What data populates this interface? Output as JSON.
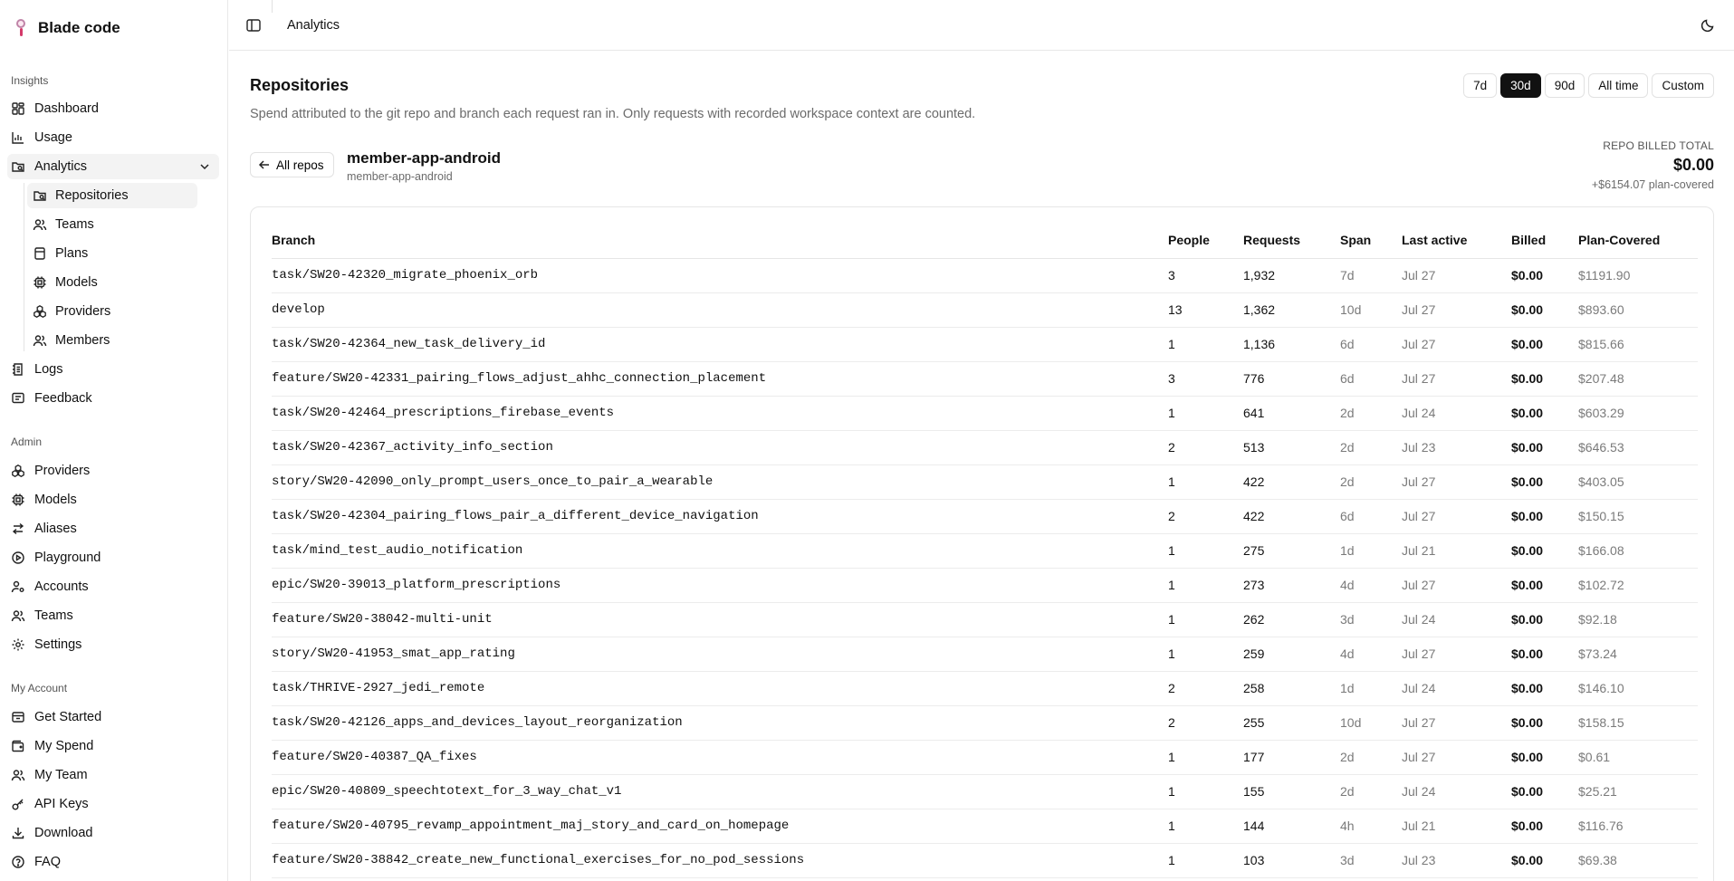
{
  "brand": {
    "name": "Blade code"
  },
  "sidebar": {
    "sections": [
      {
        "label": "Insights"
      },
      {
        "label": "Admin"
      },
      {
        "label": "My Account"
      }
    ],
    "insights": [
      {
        "label": "Dashboard",
        "icon": "layout-grid-icon"
      },
      {
        "label": "Usage",
        "icon": "bar-chart-icon"
      },
      {
        "label": "Analytics",
        "icon": "folder-search-icon"
      }
    ],
    "analytics_sub": [
      {
        "label": "Repositories",
        "icon": "folder-search-icon"
      },
      {
        "label": "Teams",
        "icon": "users-icon"
      },
      {
        "label": "Plans",
        "icon": "file-icon"
      },
      {
        "label": "Models",
        "icon": "cpu-icon"
      },
      {
        "label": "Providers",
        "icon": "boxes-icon"
      },
      {
        "label": "Members",
        "icon": "users-icon"
      }
    ],
    "insights_tail": [
      {
        "label": "Logs",
        "icon": "logs-icon"
      },
      {
        "label": "Feedback",
        "icon": "message-icon"
      }
    ],
    "admin": [
      {
        "label": "Providers",
        "icon": "boxes-icon"
      },
      {
        "label": "Models",
        "icon": "cpu-icon"
      },
      {
        "label": "Aliases",
        "icon": "arrows-icon"
      },
      {
        "label": "Playground",
        "icon": "play-circle-icon"
      },
      {
        "label": "Accounts",
        "icon": "user-cog-icon"
      },
      {
        "label": "Teams",
        "icon": "users-icon"
      },
      {
        "label": "Settings",
        "icon": "gear-icon"
      }
    ],
    "account": [
      {
        "label": "Get Started",
        "icon": "rocket-icon"
      },
      {
        "label": "My Spend",
        "icon": "wallet-icon"
      },
      {
        "label": "My Team",
        "icon": "users-icon"
      },
      {
        "label": "API Keys",
        "icon": "key-icon"
      },
      {
        "label": "Download",
        "icon": "download-icon"
      },
      {
        "label": "FAQ",
        "icon": "help-circle-icon"
      }
    ]
  },
  "topbar": {
    "breadcrumb": "Analytics"
  },
  "page": {
    "title": "Repositories",
    "description": "Spend attributed to the git repo and branch each request ran in. Only requests with recorded workspace context are counted.",
    "ranges": [
      "7d",
      "30d",
      "90d",
      "All time",
      "Custom"
    ],
    "selected_range": "30d"
  },
  "repo": {
    "back_label": "All repos",
    "name": "member-app-android",
    "subtitle": "member-app-android",
    "billed_label": "REPO BILLED TOTAL",
    "billed_value": "$0.00",
    "plan_covered": "+$6154.07 plan-covered"
  },
  "table": {
    "headers": [
      "Branch",
      "People",
      "Requests",
      "Span",
      "Last active",
      "Billed",
      "Plan-Covered"
    ],
    "rows": [
      [
        "task/SW20-42320_migrate_phoenix_orb",
        "3",
        "1,932",
        "7d",
        "Jul 27",
        "$0.00",
        "$1191.90"
      ],
      [
        "develop",
        "13",
        "1,362",
        "10d",
        "Jul 27",
        "$0.00",
        "$893.60"
      ],
      [
        "task/SW20-42364_new_task_delivery_id",
        "1",
        "1,136",
        "6d",
        "Jul 27",
        "$0.00",
        "$815.66"
      ],
      [
        "feature/SW20-42331_pairing_flows_adjust_ahhc_connection_placement",
        "3",
        "776",
        "6d",
        "Jul 27",
        "$0.00",
        "$207.48"
      ],
      [
        "task/SW20-42464_prescriptions_firebase_events",
        "1",
        "641",
        "2d",
        "Jul 24",
        "$0.00",
        "$603.29"
      ],
      [
        "task/SW20-42367_activity_info_section",
        "2",
        "513",
        "2d",
        "Jul 23",
        "$0.00",
        "$646.53"
      ],
      [
        "story/SW20-42090_only_prompt_users_once_to_pair_a_wearable",
        "1",
        "422",
        "2d",
        "Jul 27",
        "$0.00",
        "$403.05"
      ],
      [
        "task/SW20-42304_pairing_flows_pair_a_different_device_navigation",
        "2",
        "422",
        "6d",
        "Jul 27",
        "$0.00",
        "$150.15"
      ],
      [
        "task/mind_test_audio_notification",
        "1",
        "275",
        "1d",
        "Jul 21",
        "$0.00",
        "$166.08"
      ],
      [
        "epic/SW20-39013_platform_prescriptions",
        "1",
        "273",
        "4d",
        "Jul 27",
        "$0.00",
        "$102.72"
      ],
      [
        "feature/SW20-38042-multi-unit",
        "1",
        "262",
        "3d",
        "Jul 24",
        "$0.00",
        "$92.18"
      ],
      [
        "story/SW20-41953_smat_app_rating",
        "1",
        "259",
        "4d",
        "Jul 27",
        "$0.00",
        "$73.24"
      ],
      [
        "task/THRIVE-2927_jedi_remote",
        "2",
        "258",
        "1d",
        "Jul 24",
        "$0.00",
        "$146.10"
      ],
      [
        "task/SW20-42126_apps_and_devices_layout_reorganization",
        "2",
        "255",
        "10d",
        "Jul 27",
        "$0.00",
        "$158.15"
      ],
      [
        "feature/SW20-40387_QA_fixes",
        "1",
        "177",
        "2d",
        "Jul 27",
        "$0.00",
        "$0.61"
      ],
      [
        "epic/SW20-40809_speechtotext_for_3_way_chat_v1",
        "1",
        "155",
        "2d",
        "Jul 24",
        "$0.00",
        "$25.21"
      ],
      [
        "feature/SW20-40795_revamp_appointment_maj_story_and_card_on_homepage",
        "1",
        "144",
        "4h",
        "Jul 21",
        "$0.00",
        "$116.76"
      ],
      [
        "feature/SW20-38842_create_new_functional_exercises_for_no_pod_sessions",
        "1",
        "103",
        "3d",
        "Jul 23",
        "$0.00",
        "$69.38"
      ]
    ]
  }
}
